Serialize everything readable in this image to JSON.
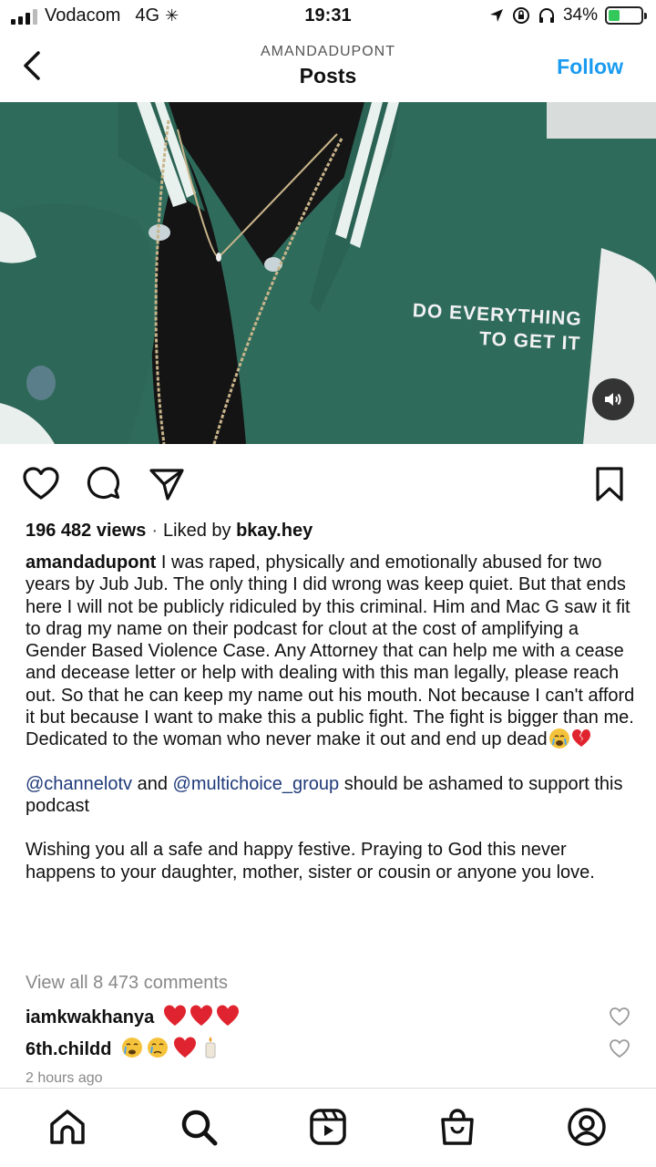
{
  "status_bar": {
    "carrier": "Vodacom",
    "network": "4G",
    "time": "19:31",
    "battery_percent": "34%",
    "battery_level": 0.34
  },
  "header": {
    "username": "AMANDADUPONT",
    "title": "Posts",
    "follow_label": "Follow"
  },
  "post": {
    "jacket_text_line1": "DO EVERYTHING",
    "jacket_text_line2": "TO GET IT",
    "views": "196 482 views",
    "liked_by_prefix": "Liked by",
    "liked_by_user": "bkay.hey",
    "caption_user": "amandadupont",
    "caption_text": "I was raped, physically and emotionally abused for two years by Jub Jub. The only thing I did wrong was keep quiet. But that ends here I will not be publicly ridiculed by this criminal. Him and Mac G saw it fit to drag my name on their podcast for clout at the cost of amplifying a Gender Based Violence Case. Any Attorney that can help me with a cease and decease letter or help with dealing with this man legally, please reach out. So that he can keep my name out his mouth. Not because I can't afford it but because I want to make this a public fight. The fight is bigger than me. Dedicated to the woman who never make it out and end up dead",
    "mention1": "@channelotv",
    "mention_and": "and",
    "mention2": "@multichoice_group",
    "mention_tail": "should be ashamed to support this podcast",
    "paragraph3": "Wishing you all a safe and happy festive. Praying to God this never happens to your daughter, mother, sister or cousin or anyone you love.",
    "view_all_comments": "View all 8 473 comments",
    "time_ago": "2 hours ago"
  },
  "comments": [
    {
      "user": "iamkwakhanya"
    },
    {
      "user": "6th.childd"
    }
  ],
  "colors": {
    "accent": "#1a9bf0",
    "mention": "#1f3a7a",
    "jacket_green": "#2f6b5b"
  },
  "tabbar": {
    "icons": [
      "home-icon",
      "search-icon",
      "reels-icon",
      "shop-icon",
      "profile-icon"
    ]
  }
}
